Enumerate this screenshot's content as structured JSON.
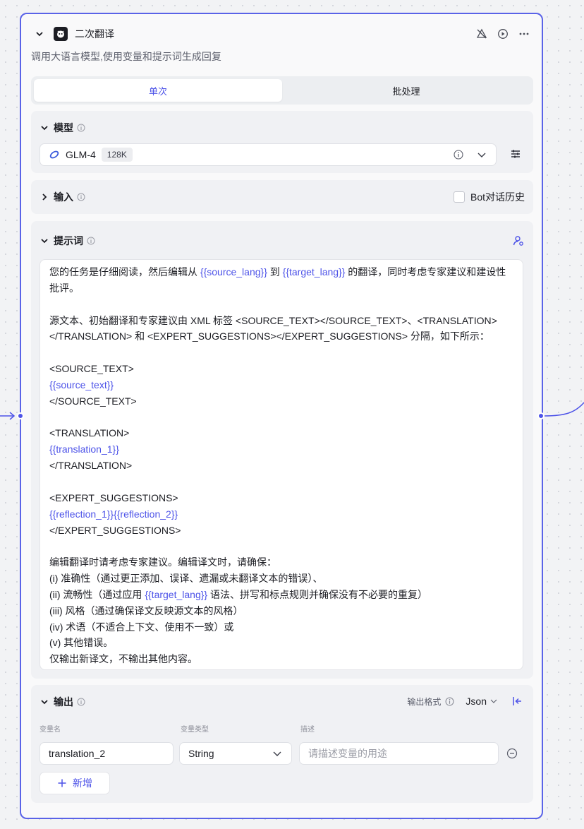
{
  "node": {
    "title": "二次翻译",
    "description": "调用大语言模型,使用变量和提示词生成回复"
  },
  "tabs": [
    "单次",
    "批处理"
  ],
  "model": {
    "section_label": "模型",
    "name": "GLM-4",
    "tag": "128K"
  },
  "input": {
    "section_label": "输入",
    "history_label": "Bot对话历史",
    "history_checked": false
  },
  "prompt": {
    "section_label": "提示词",
    "segments": [
      {
        "t": "您的任务是仔细阅读，然后编辑从 "
      },
      {
        "t": "{{source_lang}}",
        "v": true
      },
      {
        "t": " 到 "
      },
      {
        "t": "{{target_lang}}",
        "v": true
      },
      {
        "t": " 的翻译，同时考虑专家建议和建设性批评。\n\n源文本、初始翻译和专家建议由 XML 标签 <SOURCE_TEXT></SOURCE_TEXT>、<TRANSLATION></TRANSLATION> 和 <EXPERT_SUGGESTIONS></EXPERT_SUGGESTIONS> 分隔，如下所示：\n\n<SOURCE_TEXT>\n"
      },
      {
        "t": "{{source_text}}",
        "v": true
      },
      {
        "t": "\n</SOURCE_TEXT>\n\n<TRANSLATION>\n"
      },
      {
        "t": "{{translation_1}}",
        "v": true
      },
      {
        "t": "\n</TRANSLATION>\n\n<EXPERT_SUGGESTIONS>\n"
      },
      {
        "t": "{{reflection_1}}{{reflection_2}}",
        "v": true
      },
      {
        "t": "\n</EXPERT_SUGGESTIONS>\n\n编辑翻译时请考虑专家建议。编辑译文时，请确保：\n(i) 准确性（通过更正添加、误译、遗漏或未翻译文本的错误）、\n(ii) 流畅性（通过应用 "
      },
      {
        "t": "{{target_lang}}",
        "v": true
      },
      {
        "t": " 语法、拼写和标点规则并确保没有不必要的重复）\n(iii) 风格（通过确保译文反映源文本的风格）\n(iv) 术语（不适合上下文、使用不一致）或\n(v) 其他错误。\n仅输出新译文，不输出其他内容。"
      }
    ]
  },
  "output": {
    "section_label": "输出",
    "format_label": "输出格式",
    "format_value": "Json",
    "columns": {
      "name": "变量名",
      "type": "变量类型",
      "desc": "描述"
    },
    "row": {
      "name": "translation_2",
      "type": "String",
      "desc_placeholder": "请描述变量的用途"
    },
    "add_label": "新增"
  },
  "colors": {
    "accent": "#4d53e8",
    "border": "#5a63e8"
  }
}
